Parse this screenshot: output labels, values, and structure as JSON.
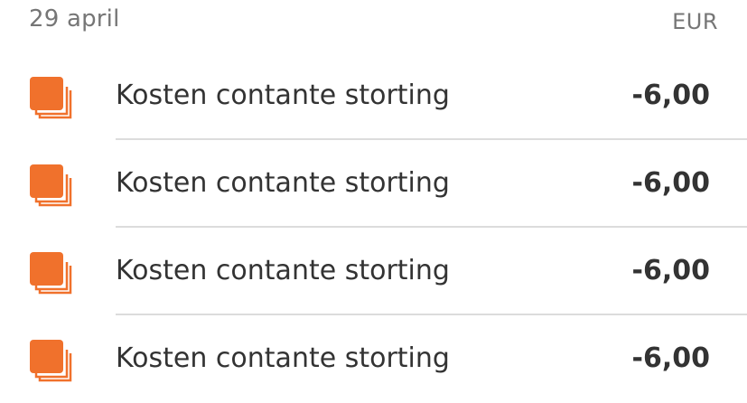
{
  "header": {
    "date": "29 april",
    "currency": "EUR"
  },
  "theme": {
    "accent": "#f0712c",
    "divider": "#dcdcdc",
    "muted_text": "#767676",
    "text": "#333333"
  },
  "transactions": [
    {
      "icon": "stacked-cards-icon",
      "description": "Kosten contante storting",
      "amount": "-6,00"
    },
    {
      "icon": "stacked-cards-icon",
      "description": "Kosten contante storting",
      "amount": "-6,00"
    },
    {
      "icon": "stacked-cards-icon",
      "description": "Kosten contante storting",
      "amount": "-6,00"
    },
    {
      "icon": "stacked-cards-icon",
      "description": "Kosten contante storting",
      "amount": "-6,00"
    }
  ]
}
